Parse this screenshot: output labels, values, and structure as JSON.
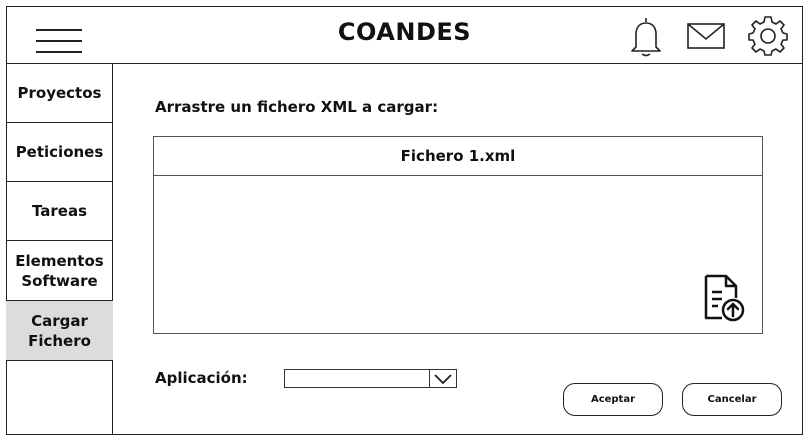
{
  "header": {
    "menu_icon": "hamburger-menu-icon",
    "title": "COANDES",
    "icons": [
      "bell-icon",
      "mail-icon",
      "gear-icon"
    ]
  },
  "sidebar": {
    "items": [
      {
        "label": "Proyectos",
        "active": false
      },
      {
        "label": "Peticiones",
        "active": false
      },
      {
        "label": "Tareas",
        "active": false
      },
      {
        "label": "Elementos\nSoftware",
        "active": false
      },
      {
        "label": "Cargar\nFichero",
        "active": true
      }
    ]
  },
  "main": {
    "upload_prompt": "Arrastre un fichero XML a cargar:",
    "file_name": "Fichero 1.xml",
    "upload_icon": "file-upload-icon",
    "application_label": "Aplicación:",
    "application_select": {
      "value": ""
    },
    "accept_label": "Aceptar",
    "cancel_label": "Cancelar"
  },
  "colors": {
    "border": "#222222",
    "active_nav": "#dcdcdc",
    "background": "#ffffff"
  }
}
